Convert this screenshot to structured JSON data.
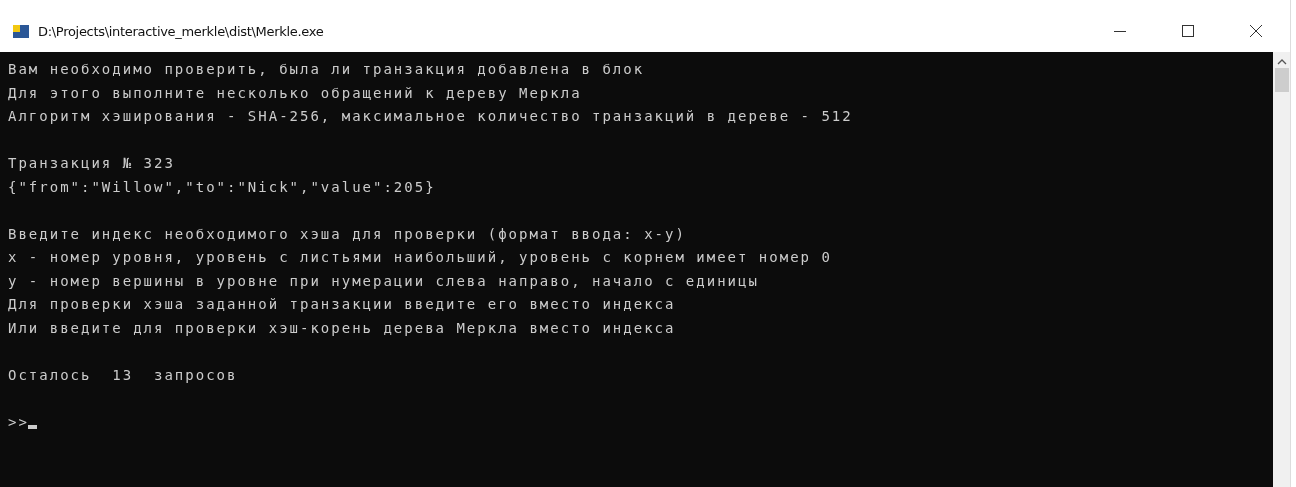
{
  "window": {
    "title": "D:\\Projects\\interactive_merkle\\dist\\Merkle.exe"
  },
  "console": {
    "blocks": [
      [
        "Вам необходимо проверить, была ли транзакция добавлена в блок",
        "Для этого выполните несколько обращений к дереву Меркла",
        "Алгоритм хэширования - SHA-256, максимальное количество транзакций в дереве - 512"
      ],
      [
        "Транзакция № 323",
        "{\"from\":\"Willow\",\"to\":\"Nick\",\"value\":205}"
      ],
      [
        "Введите индекс необходимого хэша для проверки (формат ввода: x-y)",
        "x - номер уровня, уровень с листьями наибольший, уровень с корнем имеет номер 0",
        "y - номер вершины в уровне при нумерации слева направо, начало с единицы",
        "Для проверки хэша заданной транзакции введите его вместо индекса",
        "Или введите для проверки хэш-корень дерева Меркла вместо индекса"
      ],
      [
        "Осталось  13  запросов"
      ]
    ],
    "prompt": ">>"
  }
}
